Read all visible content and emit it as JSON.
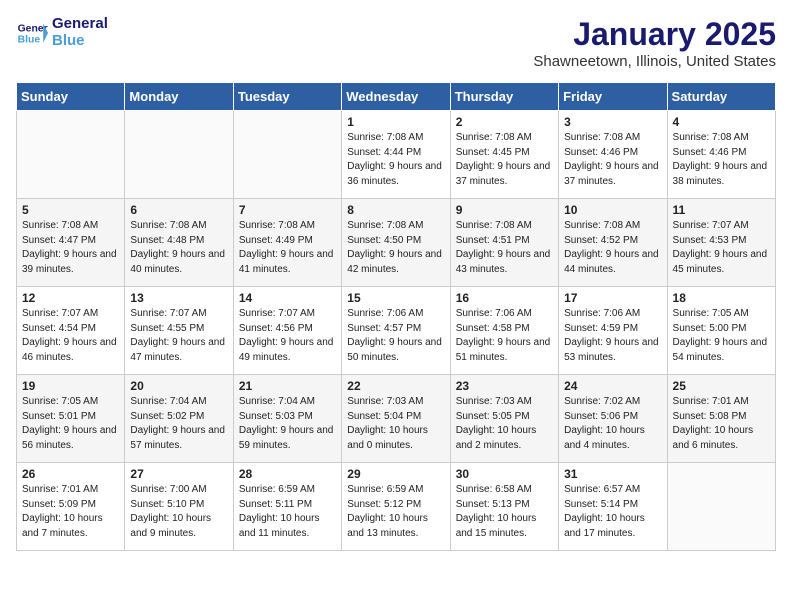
{
  "header": {
    "logo_line1": "General",
    "logo_line2": "Blue",
    "title": "January 2025",
    "subtitle": "Shawneetown, Illinois, United States"
  },
  "weekdays": [
    "Sunday",
    "Monday",
    "Tuesday",
    "Wednesday",
    "Thursday",
    "Friday",
    "Saturday"
  ],
  "weeks": [
    [
      {
        "day": "",
        "sunrise": "",
        "sunset": "",
        "daylight": ""
      },
      {
        "day": "",
        "sunrise": "",
        "sunset": "",
        "daylight": ""
      },
      {
        "day": "",
        "sunrise": "",
        "sunset": "",
        "daylight": ""
      },
      {
        "day": "1",
        "sunrise": "Sunrise: 7:08 AM",
        "sunset": "Sunset: 4:44 PM",
        "daylight": "Daylight: 9 hours and 36 minutes."
      },
      {
        "day": "2",
        "sunrise": "Sunrise: 7:08 AM",
        "sunset": "Sunset: 4:45 PM",
        "daylight": "Daylight: 9 hours and 37 minutes."
      },
      {
        "day": "3",
        "sunrise": "Sunrise: 7:08 AM",
        "sunset": "Sunset: 4:46 PM",
        "daylight": "Daylight: 9 hours and 37 minutes."
      },
      {
        "day": "4",
        "sunrise": "Sunrise: 7:08 AM",
        "sunset": "Sunset: 4:46 PM",
        "daylight": "Daylight: 9 hours and 38 minutes."
      }
    ],
    [
      {
        "day": "5",
        "sunrise": "Sunrise: 7:08 AM",
        "sunset": "Sunset: 4:47 PM",
        "daylight": "Daylight: 9 hours and 39 minutes."
      },
      {
        "day": "6",
        "sunrise": "Sunrise: 7:08 AM",
        "sunset": "Sunset: 4:48 PM",
        "daylight": "Daylight: 9 hours and 40 minutes."
      },
      {
        "day": "7",
        "sunrise": "Sunrise: 7:08 AM",
        "sunset": "Sunset: 4:49 PM",
        "daylight": "Daylight: 9 hours and 41 minutes."
      },
      {
        "day": "8",
        "sunrise": "Sunrise: 7:08 AM",
        "sunset": "Sunset: 4:50 PM",
        "daylight": "Daylight: 9 hours and 42 minutes."
      },
      {
        "day": "9",
        "sunrise": "Sunrise: 7:08 AM",
        "sunset": "Sunset: 4:51 PM",
        "daylight": "Daylight: 9 hours and 43 minutes."
      },
      {
        "day": "10",
        "sunrise": "Sunrise: 7:08 AM",
        "sunset": "Sunset: 4:52 PM",
        "daylight": "Daylight: 9 hours and 44 minutes."
      },
      {
        "day": "11",
        "sunrise": "Sunrise: 7:07 AM",
        "sunset": "Sunset: 4:53 PM",
        "daylight": "Daylight: 9 hours and 45 minutes."
      }
    ],
    [
      {
        "day": "12",
        "sunrise": "Sunrise: 7:07 AM",
        "sunset": "Sunset: 4:54 PM",
        "daylight": "Daylight: 9 hours and 46 minutes."
      },
      {
        "day": "13",
        "sunrise": "Sunrise: 7:07 AM",
        "sunset": "Sunset: 4:55 PM",
        "daylight": "Daylight: 9 hours and 47 minutes."
      },
      {
        "day": "14",
        "sunrise": "Sunrise: 7:07 AM",
        "sunset": "Sunset: 4:56 PM",
        "daylight": "Daylight: 9 hours and 49 minutes."
      },
      {
        "day": "15",
        "sunrise": "Sunrise: 7:06 AM",
        "sunset": "Sunset: 4:57 PM",
        "daylight": "Daylight: 9 hours and 50 minutes."
      },
      {
        "day": "16",
        "sunrise": "Sunrise: 7:06 AM",
        "sunset": "Sunset: 4:58 PM",
        "daylight": "Daylight: 9 hours and 51 minutes."
      },
      {
        "day": "17",
        "sunrise": "Sunrise: 7:06 AM",
        "sunset": "Sunset: 4:59 PM",
        "daylight": "Daylight: 9 hours and 53 minutes."
      },
      {
        "day": "18",
        "sunrise": "Sunrise: 7:05 AM",
        "sunset": "Sunset: 5:00 PM",
        "daylight": "Daylight: 9 hours and 54 minutes."
      }
    ],
    [
      {
        "day": "19",
        "sunrise": "Sunrise: 7:05 AM",
        "sunset": "Sunset: 5:01 PM",
        "daylight": "Daylight: 9 hours and 56 minutes."
      },
      {
        "day": "20",
        "sunrise": "Sunrise: 7:04 AM",
        "sunset": "Sunset: 5:02 PM",
        "daylight": "Daylight: 9 hours and 57 minutes."
      },
      {
        "day": "21",
        "sunrise": "Sunrise: 7:04 AM",
        "sunset": "Sunset: 5:03 PM",
        "daylight": "Daylight: 9 hours and 59 minutes."
      },
      {
        "day": "22",
        "sunrise": "Sunrise: 7:03 AM",
        "sunset": "Sunset: 5:04 PM",
        "daylight": "Daylight: 10 hours and 0 minutes."
      },
      {
        "day": "23",
        "sunrise": "Sunrise: 7:03 AM",
        "sunset": "Sunset: 5:05 PM",
        "daylight": "Daylight: 10 hours and 2 minutes."
      },
      {
        "day": "24",
        "sunrise": "Sunrise: 7:02 AM",
        "sunset": "Sunset: 5:06 PM",
        "daylight": "Daylight: 10 hours and 4 minutes."
      },
      {
        "day": "25",
        "sunrise": "Sunrise: 7:01 AM",
        "sunset": "Sunset: 5:08 PM",
        "daylight": "Daylight: 10 hours and 6 minutes."
      }
    ],
    [
      {
        "day": "26",
        "sunrise": "Sunrise: 7:01 AM",
        "sunset": "Sunset: 5:09 PM",
        "daylight": "Daylight: 10 hours and 7 minutes."
      },
      {
        "day": "27",
        "sunrise": "Sunrise: 7:00 AM",
        "sunset": "Sunset: 5:10 PM",
        "daylight": "Daylight: 10 hours and 9 minutes."
      },
      {
        "day": "28",
        "sunrise": "Sunrise: 6:59 AM",
        "sunset": "Sunset: 5:11 PM",
        "daylight": "Daylight: 10 hours and 11 minutes."
      },
      {
        "day": "29",
        "sunrise": "Sunrise: 6:59 AM",
        "sunset": "Sunset: 5:12 PM",
        "daylight": "Daylight: 10 hours and 13 minutes."
      },
      {
        "day": "30",
        "sunrise": "Sunrise: 6:58 AM",
        "sunset": "Sunset: 5:13 PM",
        "daylight": "Daylight: 10 hours and 15 minutes."
      },
      {
        "day": "31",
        "sunrise": "Sunrise: 6:57 AM",
        "sunset": "Sunset: 5:14 PM",
        "daylight": "Daylight: 10 hours and 17 minutes."
      },
      {
        "day": "",
        "sunrise": "",
        "sunset": "",
        "daylight": ""
      }
    ]
  ]
}
